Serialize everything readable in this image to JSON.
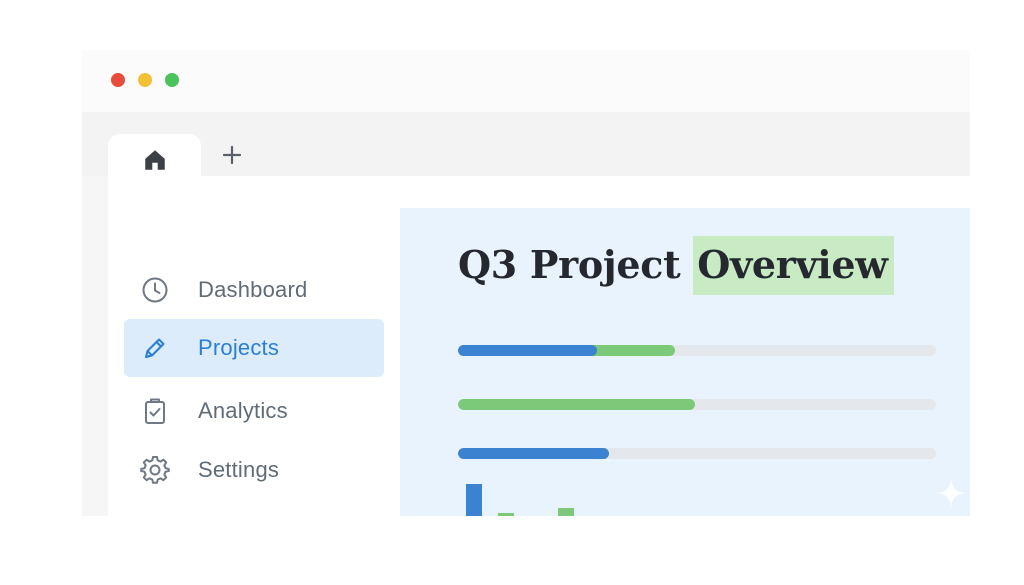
{
  "window": {
    "controls": {
      "close_color": "#e74c3c",
      "minimize_color": "#f2c037",
      "maximize_color": "#4cc35a"
    }
  },
  "tabs": {
    "home_icon": "home-icon",
    "new_tab_icon": "plus-icon"
  },
  "sidebar": {
    "items": [
      {
        "label": "Dashboard",
        "icon": "clock-icon",
        "active": false
      },
      {
        "label": "Projects",
        "icon": "pencil-icon",
        "active": true
      },
      {
        "label": "Analytics",
        "icon": "clipboard-check-icon",
        "active": false
      },
      {
        "label": "Settings",
        "icon": "gear-icon",
        "active": false
      }
    ]
  },
  "main": {
    "title_prefix": "Q3 Project",
    "title_highlight": "Overview",
    "progress_bars": [
      {
        "segments": [
          {
            "color": "#3b82d0",
            "fraction": 0.29
          },
          {
            "color": "#7cc97a",
            "fraction": 0.165
          }
        ]
      },
      {
        "segments": [
          {
            "color": "#7cc97a",
            "fraction": 0.495
          }
        ]
      },
      {
        "segments": [
          {
            "color": "#3b82d0",
            "fraction": 0.315
          }
        ]
      }
    ],
    "mini_chart_colors": [
      "#3b82d0",
      "#7cc97a",
      "#7cc97a"
    ],
    "accent_color": "#2b7fd3",
    "highlight_color": "#c8ebc3"
  }
}
